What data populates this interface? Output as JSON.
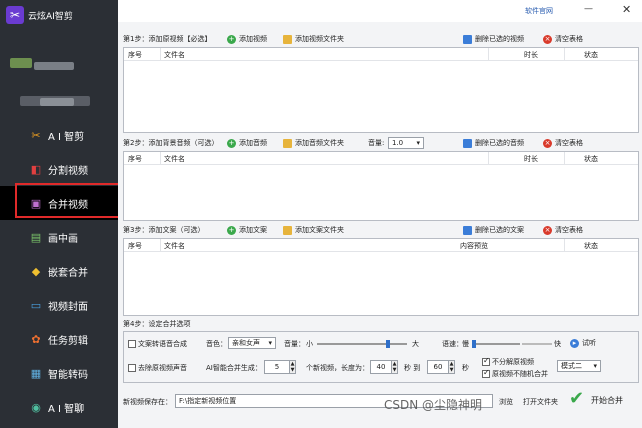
{
  "app": {
    "title": "云炫AI智剪"
  },
  "topbar": {
    "official_link": "软件官网"
  },
  "sidebar": {
    "items": [
      {
        "label": "A I 智剪",
        "icon": "scissors-icon"
      },
      {
        "label": "分割视频",
        "icon": "split-icon"
      },
      {
        "label": "合并视频",
        "icon": "merge-icon",
        "active": true
      },
      {
        "label": "画中画",
        "icon": "picture-in-picture-icon"
      },
      {
        "label": "嵌套合并",
        "icon": "nested-merge-icon"
      },
      {
        "label": "视频封面",
        "icon": "cover-icon"
      },
      {
        "label": "任务剪辑",
        "icon": "task-icon"
      },
      {
        "label": "智能转码",
        "icon": "transcode-icon"
      },
      {
        "label": "A I 智聊",
        "icon": "chat-icon"
      }
    ]
  },
  "step1": {
    "title": "第1步：添加原视频【必选】",
    "add": "添加视频",
    "add_folder": "添加视频文件夹",
    "delete": "删除已选的视频",
    "clear": "清空表格",
    "columns": [
      "序号",
      "文件名",
      "时长",
      "状态"
    ]
  },
  "step2": {
    "title": "第2步：添加背景音频（可选）",
    "add": "添加音频",
    "add_folder": "添加音频文件夹",
    "volume_label": "音量:",
    "volume_value": "1.0",
    "delete": "删除已选的音频",
    "clear": "清空表格",
    "columns": [
      "序号",
      "文件名",
      "时长",
      "状态"
    ]
  },
  "step3": {
    "title": "第3步：添加文案（可选）",
    "add": "添加文案",
    "add_folder": "添加文案文件夹",
    "delete": "删除已选的文案",
    "clear": "清空表格",
    "columns": [
      "序号",
      "文件名",
      "内容预览",
      "状态"
    ]
  },
  "step4": {
    "title": "第4步：设定合并选项",
    "tts_label": "文案转语音合成",
    "voice_label": "音色：",
    "voice_value": "亲和女声",
    "volume_label": "音量：",
    "volume_small": "小",
    "volume_big": "大",
    "speed_label": "语速：",
    "speed_slow": "慢",
    "speed_fast": "快",
    "try_listen": "试听",
    "remove_audio_label": "去除原视频声音",
    "ai_merge_label": "AI智能合并生成：",
    "ai_merge_count": "5",
    "new_video_label": "个新视频，长度为：",
    "len_from": "40",
    "sec_to": "秒 到",
    "len_to": "60",
    "sec": "秒",
    "no_split_label": "不分解原视频",
    "no_random_label": "原视频不随机合并",
    "mode_value": "模式二"
  },
  "save": {
    "label": "新视频保存在：",
    "path": "F:\\指定新视频位置",
    "browse": "浏览",
    "open_folder": "打开文件夹",
    "start": "开始合并"
  },
  "watermark": "CSDN @尘隐神明"
}
